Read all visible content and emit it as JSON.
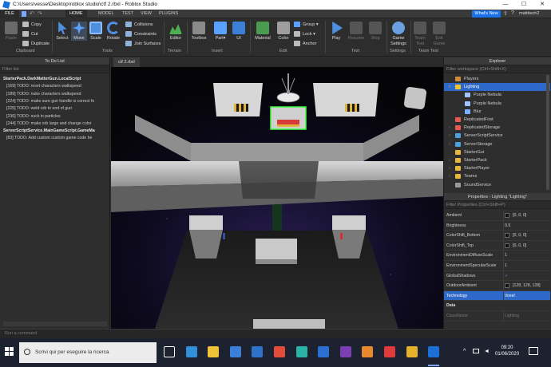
{
  "window": {
    "title": "C:\\Users\\vesse\\Desktop\\roblox studio\\ctf 2.rbxl - Roblox Studio",
    "minimize": "—",
    "maximize": "☐",
    "close": "✕"
  },
  "menu": {
    "file": "FILE",
    "tabs": [
      "HOME",
      "MODEL",
      "TEST",
      "VIEW",
      "PLUGINS"
    ],
    "whats_new": "What's New",
    "user": "mattitech2"
  },
  "ribbon": {
    "clipboard": {
      "paste": "Paste",
      "copy": "Copy",
      "cut": "Cut",
      "duplicate": "Duplicate",
      "group_label": "Clipboard"
    },
    "tools": {
      "select": "Select",
      "move": "Move",
      "scale": "Scale",
      "rotate": "Rotate",
      "collisions": "Collisions",
      "constraints": "Constraints",
      "join_surfaces": "Join Surfaces",
      "group_label": "Tools"
    },
    "terrain": {
      "editor": "Editor",
      "group_label": "Terrain"
    },
    "insert": {
      "toolbox": "Toolbox",
      "part": "Part",
      "ui": "UI",
      "group_label": "Insert"
    },
    "edit": {
      "material": "Material",
      "color": "Color",
      "group": "Group",
      "lock": "Lock",
      "anchor": "Anchor",
      "group_label": "Edit"
    },
    "test": {
      "play": "Play",
      "resume": "Resume",
      "stop": "Stop",
      "group_label": "Test"
    },
    "settings": {
      "game_settings_line1": "Game",
      "game_settings_line2": "Settings",
      "group_label": "Settings"
    },
    "team_test": {
      "team_test_line1": "Team",
      "team_test_line2": "Test",
      "exit_game_line1": "Exit",
      "exit_game_line2": "Game",
      "group_label": "Team Test"
    }
  },
  "todo_panel": {
    "title": "To Do List",
    "filter_placeholder": "Filter list",
    "lines": [
      {
        "text": "StarterPack.DarkMatterGun.LocalScript",
        "head": true
      },
      {
        "text": "[169] TODO: reset characters walkspeed",
        "head": false
      },
      {
        "text": "[189] TODO: nuke characters walkspeed",
        "head": false
      },
      {
        "text": "[224] TODO: make sure gun handle is correct fo",
        "head": false
      },
      {
        "text": "[225] TODO: weld orb to end of gun",
        "head": false
      },
      {
        "text": "[236] TODO: suck in particles",
        "head": false
      },
      {
        "text": "[244] TODO: make orb large and change color",
        "head": false
      },
      {
        "text": "ServerScriptService.MainGameScript.GameMa",
        "head": true
      },
      {
        "text": "[83] TODO: Add custom custom game code he",
        "head": false
      }
    ]
  },
  "document_tab": "ctf 2.rbxl",
  "explorer": {
    "title": "Explorer",
    "filter_placeholder": "Filter workspace (Ctrl+Shift+X)",
    "items": [
      {
        "label": "Players",
        "icon": "players-icon",
        "color": "#d28b3a",
        "indent": 0,
        "expandable": false,
        "selected": false
      },
      {
        "label": "Lighting",
        "icon": "lighting-icon",
        "color": "#f2c431",
        "indent": 0,
        "expandable": true,
        "expanded": true,
        "selected": true
      },
      {
        "label": "Purple Nebula",
        "icon": "sky-icon",
        "color": "#9fc4ff",
        "indent": 1,
        "expandable": false,
        "selected": false
      },
      {
        "label": "Purple Nebula",
        "icon": "sky-icon",
        "color": "#9fc4ff",
        "indent": 1,
        "expandable": false,
        "selected": false
      },
      {
        "label": "Blur",
        "icon": "blur-icon",
        "color": "#7ab0ff",
        "indent": 1,
        "expandable": false,
        "selected": false
      },
      {
        "label": "ReplicatedFirst",
        "icon": "replicated-first-icon",
        "color": "#e85a4f",
        "indent": 0,
        "expandable": false,
        "selected": false
      },
      {
        "label": "ReplicatedStorage",
        "icon": "replicated-storage-icon",
        "color": "#e85a4f",
        "indent": 0,
        "expandable": true,
        "selected": false
      },
      {
        "label": "ServerScriptService",
        "icon": "server-script-service-icon",
        "color": "#4aa3df",
        "indent": 0,
        "expandable": true,
        "selected": false
      },
      {
        "label": "ServerStorage",
        "icon": "server-storage-icon",
        "color": "#4aa3df",
        "indent": 0,
        "expandable": true,
        "selected": false
      },
      {
        "label": "StarterGui",
        "icon": "starter-gui-icon",
        "color": "#e9b640",
        "indent": 0,
        "expandable": false,
        "selected": false
      },
      {
        "label": "StarterPack",
        "icon": "starter-pack-icon",
        "color": "#e9b640",
        "indent": 0,
        "expandable": true,
        "selected": false
      },
      {
        "label": "StarterPlayer",
        "icon": "starter-player-icon",
        "color": "#e9b640",
        "indent": 0,
        "expandable": true,
        "selected": false
      },
      {
        "label": "Teams",
        "icon": "teams-icon",
        "color": "#e9b640",
        "indent": 0,
        "expandable": true,
        "selected": false
      },
      {
        "label": "SoundService",
        "icon": "sound-service-icon",
        "color": "#9a9a9a",
        "indent": 0,
        "expandable": false,
        "selected": false
      }
    ]
  },
  "properties": {
    "title": "Properties - Lighting \"Lighting\"",
    "filter_placeholder": "Filter Properties (Ctrl+Shift+P)",
    "rows": [
      {
        "name": "Ambient",
        "value": "[0, 0, 0]",
        "swatch": true,
        "selected": false
      },
      {
        "name": "Brightness",
        "value": "0.5",
        "swatch": false,
        "selected": false
      },
      {
        "name": "ColorShift_Bottom",
        "value": "[0, 0, 0]",
        "swatch": true,
        "selected": false
      },
      {
        "name": "ColorShift_Top",
        "value": "[0, 0, 0]",
        "swatch": true,
        "selected": false
      },
      {
        "name": "EnvironmentDiffuseScale",
        "value": "1",
        "swatch": false,
        "selected": false
      },
      {
        "name": "EnvironmentSpecularScale",
        "value": "1",
        "swatch": false,
        "selected": false
      },
      {
        "name": "GlobalShadows",
        "value": "✓",
        "swatch": false,
        "selected": false
      },
      {
        "name": "OutdoorAmbient",
        "value": "[128, 128, 128]",
        "swatch": true,
        "selected": false
      },
      {
        "name": "Technology",
        "value": "Voxel",
        "swatch": false,
        "selected": true
      },
      {
        "name": "Data",
        "value": "",
        "swatch": false,
        "selected": false,
        "category": true
      },
      {
        "name": "ClassName",
        "value": "Lighting",
        "swatch": false,
        "selected": false,
        "faded": true
      }
    ]
  },
  "command_bar": {
    "placeholder": "Run a command"
  },
  "taskbar": {
    "search_placeholder": "Scrivi qui per eseguire la ricerca",
    "time": "09:20",
    "date": "01/06/2020",
    "apps": [
      {
        "icon": "task-view-icon",
        "color": "#ffffff"
      },
      {
        "icon": "edge-icon",
        "color": "#2f8fd8"
      },
      {
        "icon": "file-explorer-icon",
        "color": "#f0c23a"
      },
      {
        "icon": "store-icon",
        "color": "#3b7fd8"
      },
      {
        "icon": "mail-icon",
        "color": "#2f73c8"
      },
      {
        "icon": "chrome-icon",
        "color": "#e34c3b"
      },
      {
        "icon": "edge-new-icon",
        "color": "#2bb3a8"
      },
      {
        "icon": "dropbox-icon",
        "color": "#2a6fd1"
      },
      {
        "icon": "app-jw-icon",
        "color": "#7c3fb3"
      },
      {
        "icon": "blender-icon",
        "color": "#e9892e"
      },
      {
        "icon": "roblox-icon",
        "color": "#e03a3a"
      },
      {
        "icon": "sketch-icon",
        "color": "#e6b12b"
      },
      {
        "icon": "roblox-studio-icon",
        "color": "#1b70d8"
      }
    ]
  }
}
